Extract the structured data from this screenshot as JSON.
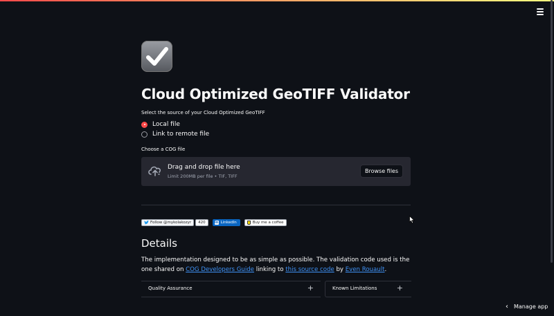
{
  "app": {
    "title": "Cloud Optimized GeoTIFF Validator",
    "icon": "checkmark-icon",
    "menu_icon": "hamburger-menu-icon"
  },
  "source": {
    "prompt": "Select the source of your Cloud Optimized GeoTIFF",
    "options": [
      "Local file",
      "Link to remote file"
    ],
    "selected": "Local file"
  },
  "uploader": {
    "label": "Choose a COG file",
    "drop_text": "Drag and drop file here",
    "limit_text": "Limit 200MB per file • TIF, TIFF",
    "browse_label": "Browse files",
    "icon": "cloud-upload-icon"
  },
  "badges": {
    "twitter_label": "Follow @mykolakozyr",
    "twitter_count": "420",
    "linkedin_label": "LinkedIn",
    "coffee_label": "Buy me a coffee"
  },
  "details": {
    "heading": "Details",
    "text_1": "The implementation designed to be as simple as possible. The validation code used is the one shared on ",
    "link_1": "COG Developers Guide",
    "text_2": " linking to ",
    "link_2": "this source code",
    "text_3": " by ",
    "link_3": "Even Rouault",
    "text_4": "."
  },
  "expanders": [
    {
      "label": "Quality Assurance",
      "icon": "plus-icon"
    },
    {
      "label": "Known Limitations",
      "icon": "plus-icon"
    }
  ],
  "footer": {
    "manage_label": "Manage app",
    "icon": "chevron-left-icon"
  },
  "colors": {
    "background": "#0e1117",
    "accent": "#ff4b4b",
    "panel": "#262730",
    "link": "#3f92f6"
  }
}
